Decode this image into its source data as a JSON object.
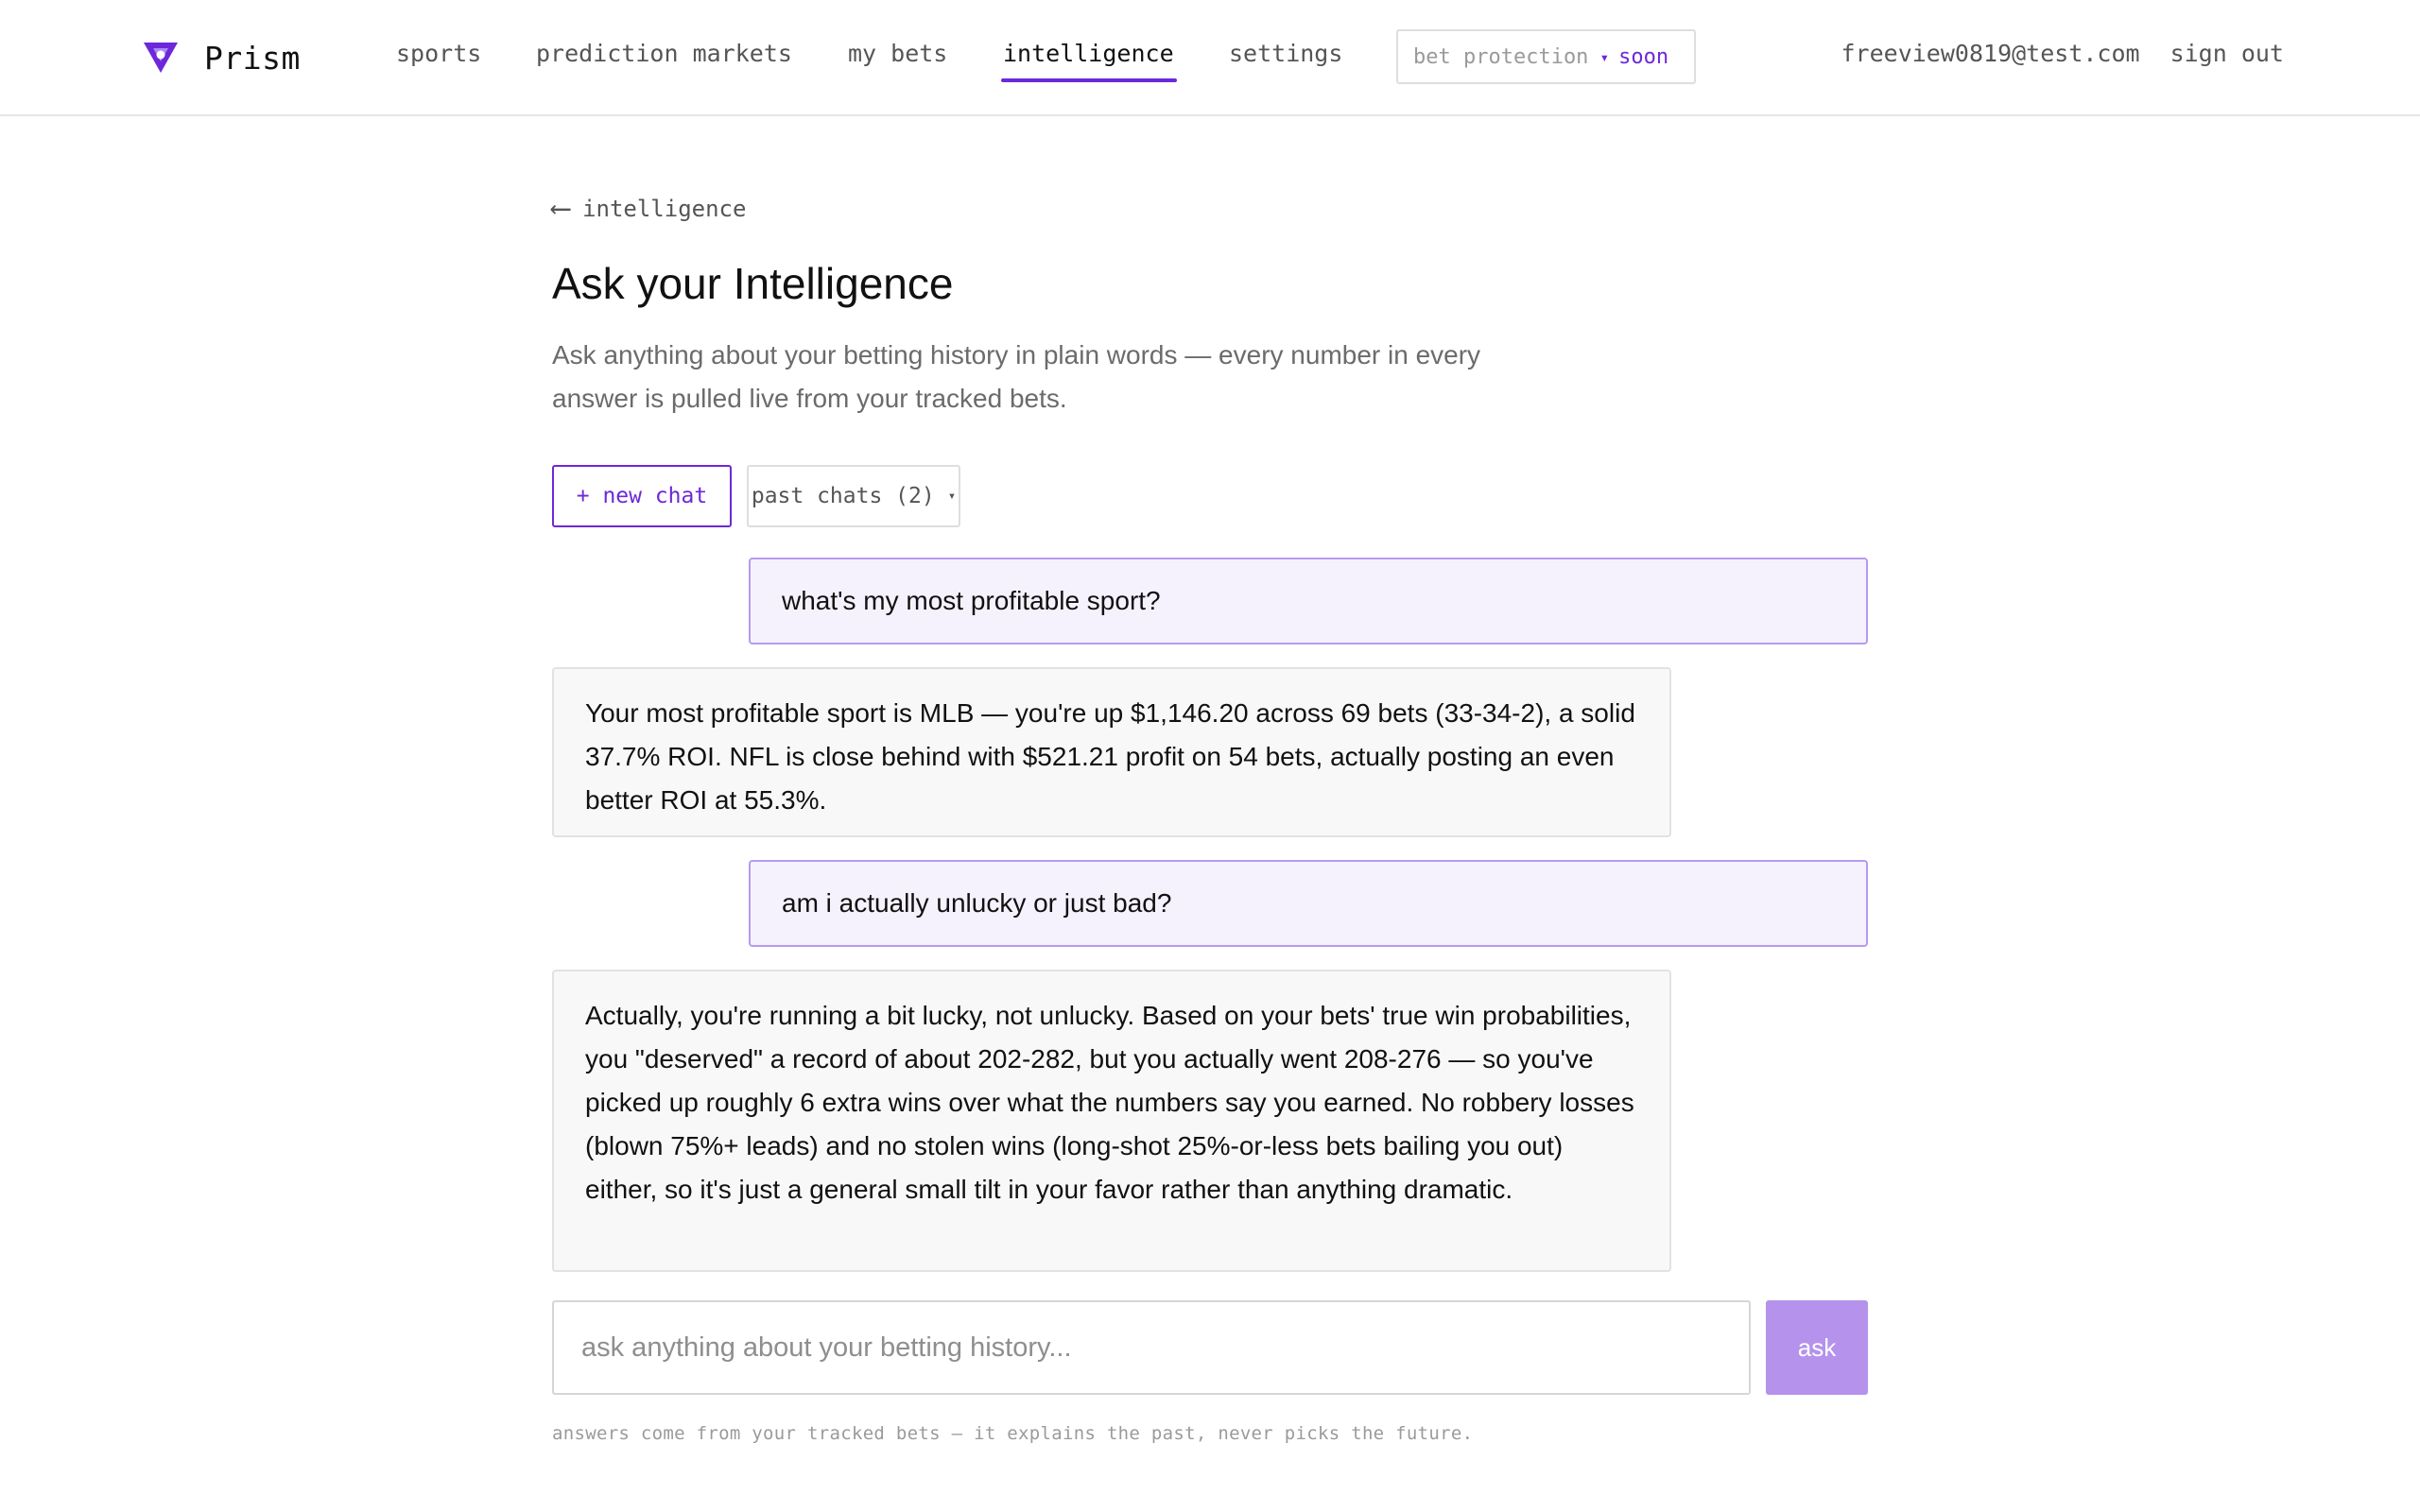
{
  "header": {
    "brand": "Prism",
    "nav": [
      "sports",
      "prediction markets",
      "my bets",
      "intelligence",
      "settings"
    ],
    "active_nav": "intelligence",
    "bet_protection": {
      "label": "bet protection",
      "separator": "▾",
      "status": "soon"
    },
    "user_email": "freeview0819@test.com",
    "sign_out": "sign out"
  },
  "main": {
    "back_arrow": "⟵",
    "back_label": "intelligence",
    "title": "Ask your Intelligence",
    "subtitle": "Ask anything about your betting history in plain words — every number in every answer is pulled live from your tracked bets.",
    "new_chat_label": "+ new chat",
    "past_chats_label": "past chats (2)",
    "past_chats_caret": "▾",
    "messages": [
      {
        "role": "user",
        "text": "what's my most profitable sport?"
      },
      {
        "role": "assistant",
        "text": "Your most profitable sport is MLB — you're up $1,146.20 across 69 bets (33-34-2), a solid 37.7% ROI. NFL is close behind with $521.21 profit on 54 bets, actually posting an even better ROI at 55.3%."
      },
      {
        "role": "user",
        "text": "am i actually unlucky or just bad?"
      },
      {
        "role": "assistant",
        "text": "Actually, you're running a bit lucky, not unlucky. Based on your bets' true win probabilities, you \"deserved\" a record of about 202-282, but you actually went 208-276 — so you've picked up roughly 6 extra wins over what the numbers say you earned. No robbery losses (blown 75%+ leads) and no stolen wins (long-shot 25%-or-less bets bailing you out) either, so it's just a general small tilt in your favor rather than anything dramatic."
      }
    ],
    "input_placeholder": "ask anything about your betting history...",
    "ask_label": "ask",
    "footnote": "answers come from your tracked bets — it explains the past, never picks the future."
  },
  "colors": {
    "accent": "#6d28d9",
    "user_bubble_bg": "#f5f2fd",
    "user_bubble_border": "#b79af0",
    "ai_bubble_bg": "#f8f8f8",
    "ask_button": "#b592ec"
  },
  "icons": {
    "brand_logo": "prism-triangle-logo",
    "back": "left-arrow-icon"
  }
}
